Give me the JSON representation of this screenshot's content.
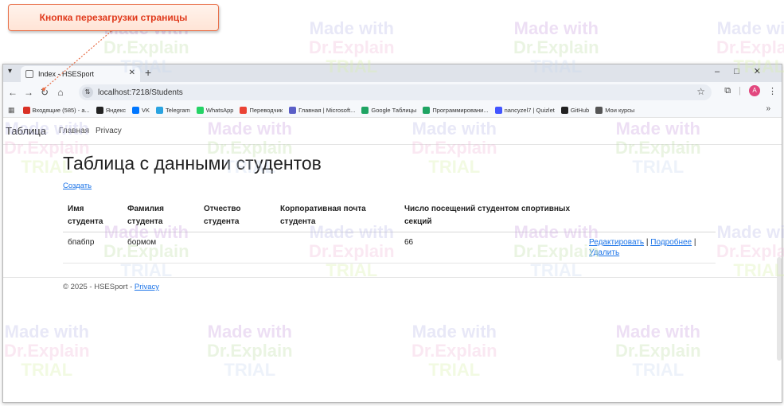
{
  "callout": {
    "text": "Кнопка перезагрузки страницы"
  },
  "watermark": {
    "line1": "Made with",
    "line2": "Dr.Explain",
    "line3": "TRIAL"
  },
  "browser": {
    "tab_title": "Index - HSESport",
    "new_tab": "+",
    "url": "localhost:7218/Students",
    "bookmarks": [
      {
        "label": "Входящие (585) - a...",
        "color": "#d93025"
      },
      {
        "label": "Яндекс",
        "color": "#222222"
      },
      {
        "label": "VK",
        "color": "#0077ff"
      },
      {
        "label": "Telegram",
        "color": "#2aa3e0"
      },
      {
        "label": "WhatsApp",
        "color": "#25d366"
      },
      {
        "label": "Переводчик",
        "color": "#ea4335"
      },
      {
        "label": "Главная | Microsoft...",
        "color": "#5b5fc7"
      },
      {
        "label": "Google Таблицы",
        "color": "#1fa463"
      },
      {
        "label": "Программировани...",
        "color": "#1fa463"
      },
      {
        "label": "nancyzel7 | Quizlet",
        "color": "#4255ff"
      },
      {
        "label": "GitHub",
        "color": "#222222"
      },
      {
        "label": "Мои курсы",
        "color": "#555555"
      }
    ],
    "bookmarks_more": "»",
    "avatar": "A"
  },
  "page": {
    "brand": "Таблица",
    "nav": [
      "Главная",
      "Privacy"
    ],
    "title": "Таблица с данными студентов",
    "create_link": "Создать",
    "columns": [
      "Имя студента",
      "Фамилия студента",
      "Отчество студента",
      "Корпоративная почта студента",
      "Число посещений студентом спортивных секций",
      ""
    ],
    "rows": [
      {
        "first_name": "бпабпр",
        "last_name": "бормом",
        "middle_name": "",
        "email": "",
        "visits": "66",
        "actions": {
          "edit": "Редактировать",
          "details": "Подробнее",
          "delete": "Удалить",
          "sep": "|"
        }
      }
    ],
    "footer": {
      "text": "© 2025 - HSESport - ",
      "privacy": "Privacy"
    }
  }
}
